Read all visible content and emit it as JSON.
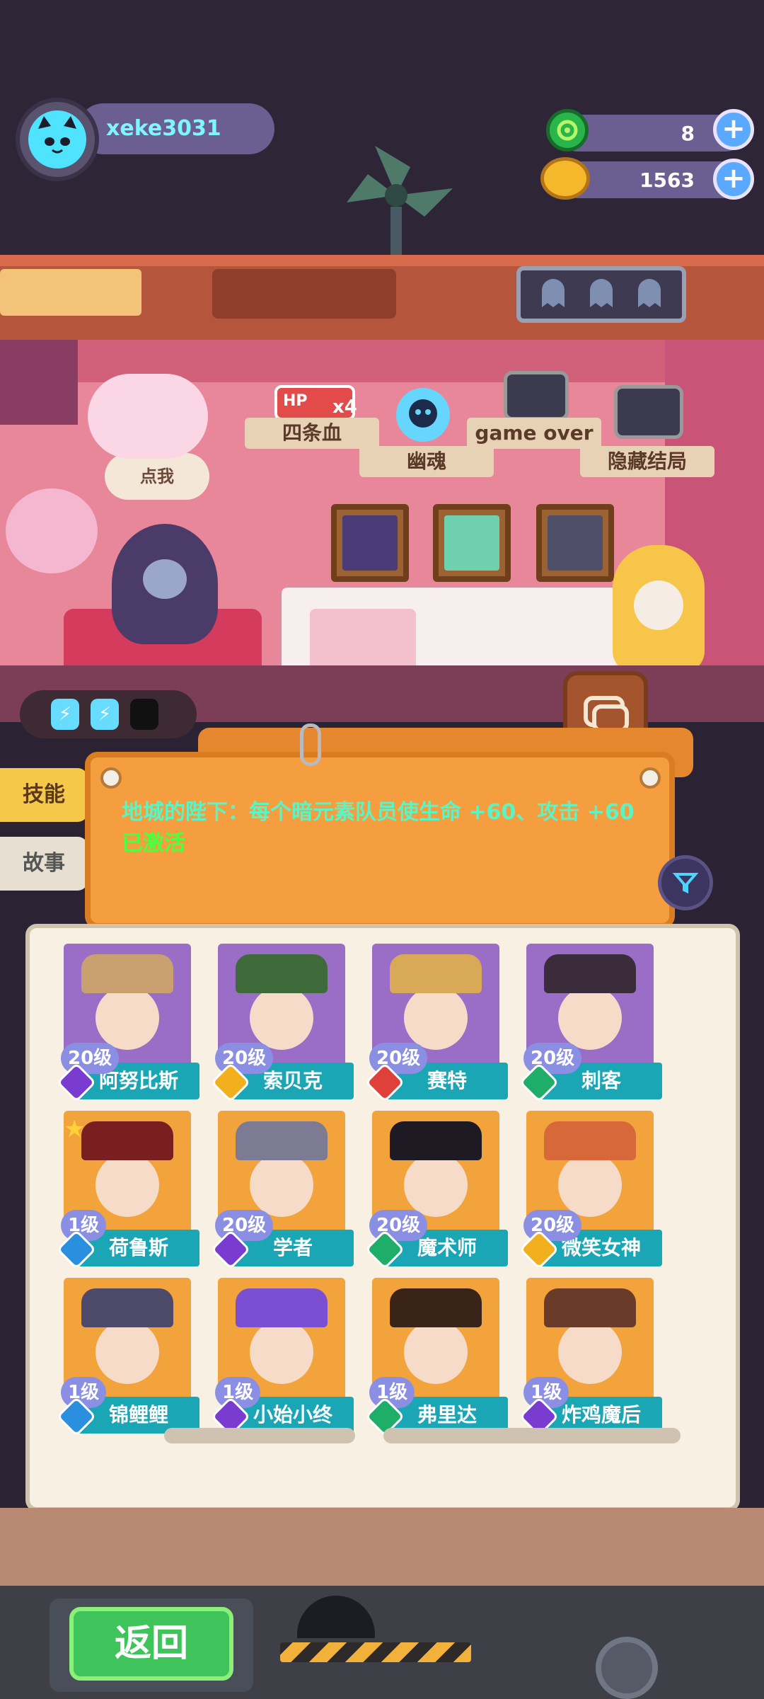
{
  "player": {
    "name": "xeke3031"
  },
  "currencies": [
    {
      "name": "gem",
      "value": "8",
      "color": "#2ab54a"
    },
    {
      "name": "coin",
      "value": "1563",
      "color": "#f5b82a"
    }
  ],
  "stage": {
    "speech": "点我",
    "labels": [
      "四条血",
      "幽魂",
      "game over",
      "隐藏结局"
    ],
    "hp_badge": "HP",
    "hp_multiplier": "x4"
  },
  "energy": {
    "filled": 2,
    "total": 3,
    "glyph": "⚡"
  },
  "tabs": [
    {
      "label": "技能",
      "active": true
    },
    {
      "label": "故事",
      "active": false
    }
  ],
  "skill_card": {
    "text": "地城的陛下：每个暗元素队员使生命 +60、攻击 +60",
    "status": "已激活"
  },
  "heroes": [
    {
      "name": "阿努比斯",
      "level": "20级",
      "rarity": "#7a3bd1",
      "hat": "#c9a070"
    },
    {
      "name": "索贝克",
      "level": "20级",
      "rarity": "#f2b01e",
      "hat": "#3f6b3b"
    },
    {
      "name": "赛特",
      "level": "20级",
      "rarity": "#e0403a",
      "hat": "#d8a957"
    },
    {
      "name": "刺客",
      "level": "20级",
      "rarity": "#1fae6a",
      "hat": "#3a2c3a"
    },
    {
      "name": "荷鲁斯",
      "level": "1级",
      "rarity": "#2b8fe0",
      "hat": "#7a1f1f",
      "starred": true
    },
    {
      "name": "学者",
      "level": "20级",
      "rarity": "#7a3bd1",
      "hat": "#7d7a94"
    },
    {
      "name": "魔术师",
      "level": "20级",
      "rarity": "#1fae6a",
      "hat": "#1e1a24"
    },
    {
      "name": "微笑女神",
      "level": "20级",
      "rarity": "#f2b01e",
      "hat": "#d7683a"
    },
    {
      "name": "锦鲤鲤",
      "level": "1级",
      "rarity": "#2b8fe0",
      "hat": "#4d4a6a"
    },
    {
      "name": "小始小终",
      "level": "1级",
      "rarity": "#7a3bd1",
      "hat": "#7a4fd1"
    },
    {
      "name": "弗里达",
      "level": "1级",
      "rarity": "#1fae6a",
      "hat": "#3a241a"
    },
    {
      "name": "炸鸡魔后",
      "level": "1级",
      "rarity": "#7a3bd1",
      "hat": "#6a3b28"
    }
  ],
  "bottom": {
    "back_label": "返回"
  }
}
